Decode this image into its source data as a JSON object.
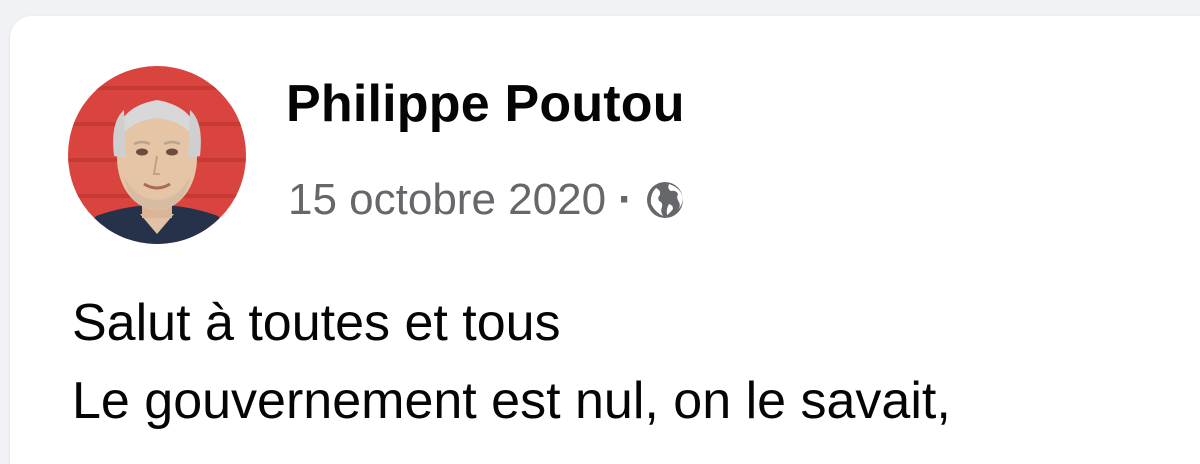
{
  "post": {
    "author": {
      "name": "Philippe Poutou",
      "avatar_icon": "profile-photo"
    },
    "meta": {
      "date": "15 octobre 2020",
      "separator": "·",
      "audience_icon": "globe-icon"
    },
    "body_lines": [
      "Salut à toutes et tous",
      "Le gouvernement est nul, on le savait,"
    ]
  },
  "colors": {
    "page_background": "#f0f2f5",
    "card_background": "#ffffff",
    "primary_text": "#050505",
    "secondary_text": "#65676b",
    "avatar_background": "#d9443f"
  }
}
